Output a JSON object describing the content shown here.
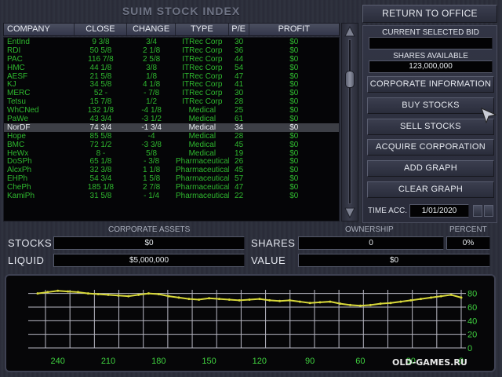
{
  "index_title": "SUIM STOCK INDEX",
  "columns": {
    "company": "COMPANY",
    "close": "CLOSE",
    "change": "CHANGE",
    "type": "TYPE",
    "pe": "P/E",
    "profit": "PROFIT"
  },
  "rows": [
    {
      "company": "EntInd",
      "close": "9 3/8",
      "change": "3/4",
      "type": "ITRec Corp",
      "pe": "30",
      "profit": "$0"
    },
    {
      "company": "RDI",
      "close": "50 5/8",
      "change": "2 1/8",
      "type": "ITRec Corp",
      "pe": "36",
      "profit": "$0"
    },
    {
      "company": "PAC",
      "close": "116 7/8",
      "change": "2 5/8",
      "type": "ITRec Corp",
      "pe": "44",
      "profit": "$0"
    },
    {
      "company": "HMC",
      "close": "44 1/8",
      "change": "3/8",
      "type": "ITRec Corp",
      "pe": "54",
      "profit": "$0"
    },
    {
      "company": "AESF",
      "close": "21 5/8",
      "change": "1/8",
      "type": "ITRec Corp",
      "pe": "47",
      "profit": "$0"
    },
    {
      "company": "KJ",
      "close": "34 5/8",
      "change": "4 1/8",
      "type": "ITRec Corp",
      "pe": "41",
      "profit": "$0"
    },
    {
      "company": "MERC",
      "close": "52 -",
      "change": "- 7/8",
      "type": "ITRec Corp",
      "pe": "30",
      "profit": "$0"
    },
    {
      "company": "Tetsu",
      "close": "15 7/8",
      "change": "1/2",
      "type": "ITRec Corp",
      "pe": "28",
      "profit": "$0"
    },
    {
      "company": "WhCNed",
      "close": "132 1/8",
      "change": "-4 1/8",
      "type": "Medical",
      "pe": "25",
      "profit": "$0"
    },
    {
      "company": "PaWe",
      "close": "43 3/4",
      "change": "-3 1/2",
      "type": "Medical",
      "pe": "61",
      "profit": "$0"
    },
    {
      "company": "NorDF",
      "close": "74 3/4",
      "change": "-1 3/4",
      "type": "Medical",
      "pe": "34",
      "profit": "$0",
      "selected": true
    },
    {
      "company": "Hope",
      "close": "85 5/8",
      "change": "-4",
      "type": "Medical",
      "pe": "28",
      "profit": "$0"
    },
    {
      "company": "BMC",
      "close": "72 1/2",
      "change": "-3 3/8",
      "type": "Medical",
      "pe": "45",
      "profit": "$0"
    },
    {
      "company": "HeWx",
      "close": "8 -",
      "change": "5/8",
      "type": "Medical",
      "pe": "19",
      "profit": "$0"
    },
    {
      "company": "DoSPh",
      "close": "65 1/8",
      "change": "- 3/8",
      "type": "Pharmaceutical",
      "pe": "26",
      "profit": "$0"
    },
    {
      "company": "AlcxPh",
      "close": "32 3/8",
      "change": "1 1/8",
      "type": "Pharmaceutical",
      "pe": "45",
      "profit": "$0"
    },
    {
      "company": "EHPh",
      "close": "54 3/4",
      "change": "1 5/8",
      "type": "Pharmaceutical",
      "pe": "57",
      "profit": "$0"
    },
    {
      "company": "ChePh",
      "close": "185 1/8",
      "change": "2 7/8",
      "type": "Pharmaceutical",
      "pe": "47",
      "profit": "$0"
    },
    {
      "company": "KamiPh",
      "close": "31 5/8",
      "change": "- 1/4",
      "type": "Pharmaceutical",
      "pe": "22",
      "profit": "$0"
    }
  ],
  "right_panel": {
    "return_label": "RETURN TO OFFICE",
    "current_bid_label": "CURRENT SELECTED BID",
    "current_bid_value": "",
    "shares_available_label": "SHARES AVAILABLE",
    "shares_available_value": "123,000,000",
    "corp_info_label": "CORPORATE INFORMATION",
    "buy_label": "BUY STOCKS",
    "sell_label": "SELL STOCKS",
    "acquire_label": "ACQUIRE CORPORATION",
    "add_graph_label": "ADD GRAPH",
    "clear_graph_label": "CLEAR GRAPH",
    "time_label": "TIME ACC.",
    "time_value": "1/01/2020"
  },
  "assets": {
    "corporate_assets_label": "CORPORATE ASSETS",
    "ownership_label": "OWNERSHIP",
    "percent_label": "PERCENT",
    "stocks_label": "STOCKS",
    "stocks_value": "$0",
    "liquid_label": "LIQUID",
    "liquid_value": "$5,000,000",
    "shares_label": "SHARES",
    "shares_value": "0",
    "percent_value": "0%",
    "value_label": "VALUE",
    "value_value": "$0"
  },
  "chart_data": {
    "type": "line",
    "x_ticks": [
      "240",
      "210",
      "180",
      "150",
      "120",
      "90",
      "60",
      "30",
      "0"
    ],
    "y_ticks": [
      "80",
      "60",
      "40",
      "20",
      "0"
    ],
    "xlim": [
      240,
      0
    ],
    "ylim": [
      0,
      90
    ],
    "grid": true,
    "series_color": "#d8d83a",
    "x": [
      252,
      246,
      240,
      234,
      228,
      222,
      216,
      210,
      204,
      198,
      192,
      186,
      180,
      174,
      168,
      162,
      156,
      150,
      144,
      138,
      132,
      126,
      120,
      114,
      108,
      102,
      96,
      90,
      84,
      78,
      72,
      66,
      60,
      54,
      48,
      42,
      36,
      30,
      24,
      18,
      12,
      6,
      0
    ],
    "values": [
      80,
      82,
      84,
      83,
      82,
      80,
      79,
      78,
      77,
      76,
      78,
      80,
      79,
      76,
      74,
      72,
      71,
      73,
      72,
      71,
      70,
      71,
      72,
      70,
      69,
      70,
      68,
      66,
      67,
      68,
      65,
      63,
      62,
      63,
      65,
      66,
      68,
      70,
      72,
      74,
      76,
      78,
      74
    ]
  },
  "watermark": "OLD-GAMES.RU"
}
